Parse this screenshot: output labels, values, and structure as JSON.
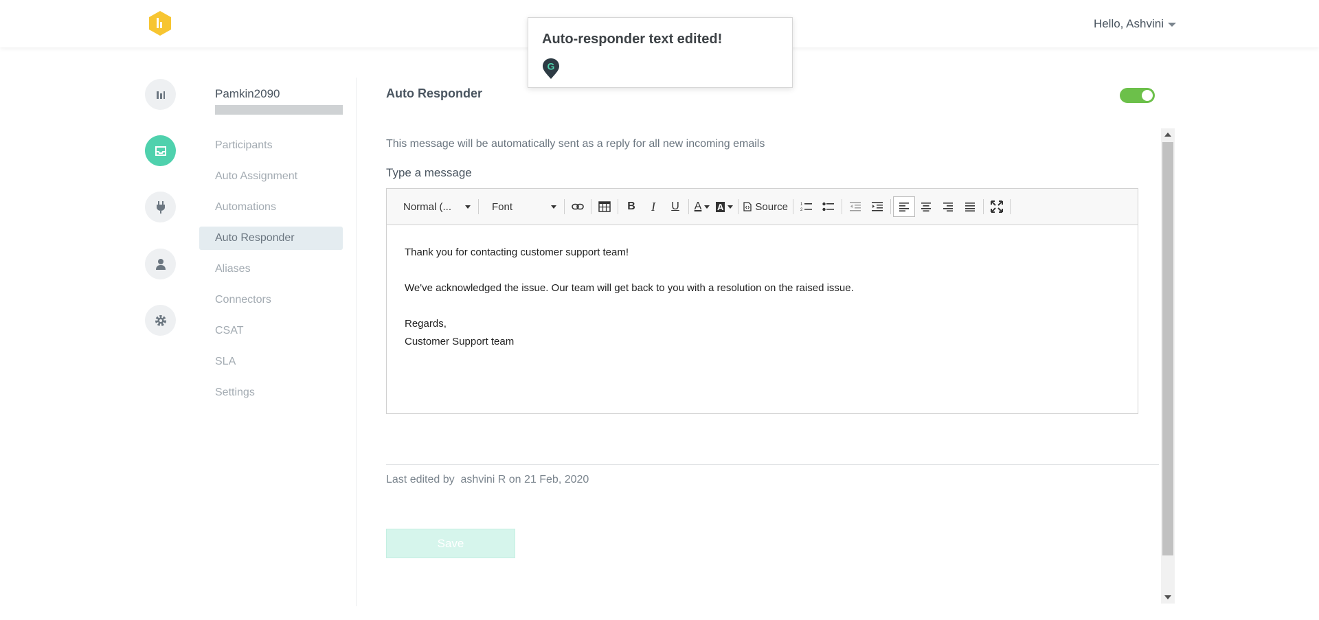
{
  "header": {
    "greeting": "Hello, Ashvini",
    "brand_color": "#f7c531"
  },
  "toast": {
    "message": "Auto-responder text edited!"
  },
  "sidebar": {
    "org_name": "Pamkin2090",
    "items": [
      {
        "label": "Participants"
      },
      {
        "label": "Auto Assignment"
      },
      {
        "label": "Automations"
      },
      {
        "label": "Auto Responder",
        "active": true
      },
      {
        "label": "Aliases"
      },
      {
        "label": "Connectors"
      },
      {
        "label": "CSAT"
      },
      {
        "label": "SLA"
      },
      {
        "label": "Settings"
      }
    ]
  },
  "rail": {
    "icons": [
      "analytics-icon",
      "inbox-icon",
      "plug-icon",
      "user-icon",
      "gear-icon"
    ],
    "active_color": "#4fd1ad"
  },
  "main": {
    "title": "Auto Responder",
    "toggle_on": true,
    "toggle_color": "#6cc04a",
    "description": "This message will be automatically sent as a reply for all new incoming emails",
    "type_label": "Type a message",
    "toolbar": {
      "format": "Normal (...",
      "font": "Font",
      "source": "Source"
    },
    "message_lines": [
      "Thank you for contacting customer support team!",
      "",
      "We've acknowledged the issue. Our team will get back to you with a resolution on the raised issue.",
      "",
      "Regards,",
      "Customer Support team"
    ],
    "last_edited": "Last edited by  ashvini R on 21 Feb, 2020",
    "save_label": "Save"
  }
}
